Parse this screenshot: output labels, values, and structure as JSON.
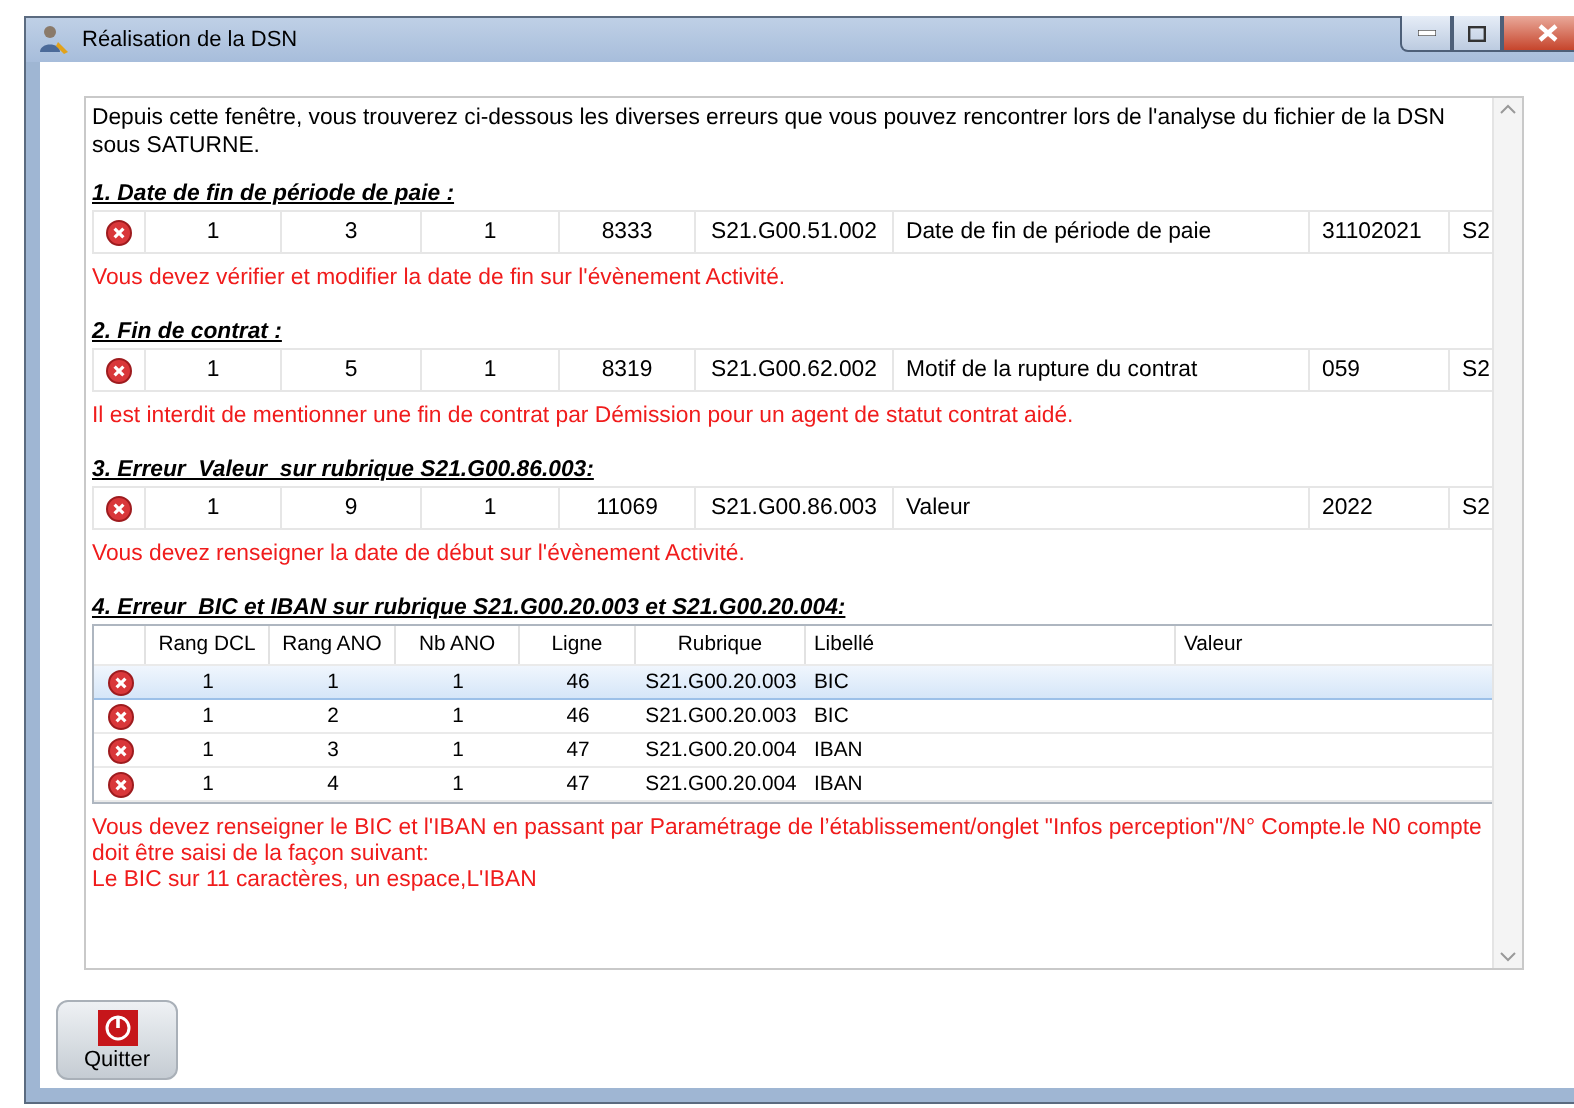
{
  "window": {
    "title": "Réalisation de la DSN"
  },
  "intro": "Depuis cette fenêtre, vous trouverez ci-dessous les diverses erreurs que vous pouvez rencontrer lors de l'analyse du fichier de la DSN sous SATURNE.",
  "sections": [
    {
      "kind": "row",
      "heading": "1. Date de fin de période de paie :",
      "cells": [
        "1",
        "3",
        "1",
        "8333",
        "S21.G00.51.002",
        "Date de fin de période de paie",
        "31102021",
        "S2"
      ],
      "message": "Vous devez vérifier et modifier la date de fin sur l'évènement Activité."
    },
    {
      "kind": "row",
      "heading": "2. Fin de contrat :",
      "cells": [
        "1",
        "5",
        "1",
        "8319",
        "S21.G00.62.002",
        "Motif de la rupture du contrat",
        "059",
        "S2"
      ],
      "message": "Il est interdit de mentionner une fin de contrat par Démission pour un agent de statut contrat aidé."
    },
    {
      "kind": "row",
      "heading": "3. Erreur  Valeur  sur rubrique S21.G00.86.003:",
      "cells": [
        "1",
        "9",
        "1",
        "11069",
        "S21.G00.86.003",
        "Valeur",
        "2022",
        "S2"
      ],
      "message": "Vous devez renseigner la date de début sur l'évènement Activité."
    },
    {
      "kind": "table",
      "heading": "4. Erreur  BIC et IBAN sur rubrique S21.G00.20.003 et S21.G00.20.004:",
      "columns": [
        "Rang DCL",
        "Rang ANO",
        "Nb ANO",
        "Ligne",
        "Rubrique",
        "Libellé",
        "Valeur"
      ],
      "rows": [
        {
          "cells": [
            "1",
            "1",
            "1",
            "46",
            "S21.G00.20.003",
            "BIC"
          ],
          "selected": true
        },
        {
          "cells": [
            "1",
            "2",
            "1",
            "46",
            "S21.G00.20.003",
            "BIC"
          ],
          "selected": false
        },
        {
          "cells": [
            "1",
            "3",
            "1",
            "47",
            "S21.G00.20.004",
            "IBAN"
          ],
          "selected": false
        },
        {
          "cells": [
            "1",
            "4",
            "1",
            "47",
            "S21.G00.20.004",
            "IBAN"
          ],
          "selected": false
        }
      ],
      "message": "Vous devez renseigner le BIC et l'IBAN en passant par  Paramétrage de l’établissement/onglet \"Infos perception\"/N° Compte.le N0 compte doit être saisi de la façon suivant:\nLe BIC sur 11 caractères, un espace,L'IBAN"
    }
  ],
  "quit_button": "Quitter"
}
